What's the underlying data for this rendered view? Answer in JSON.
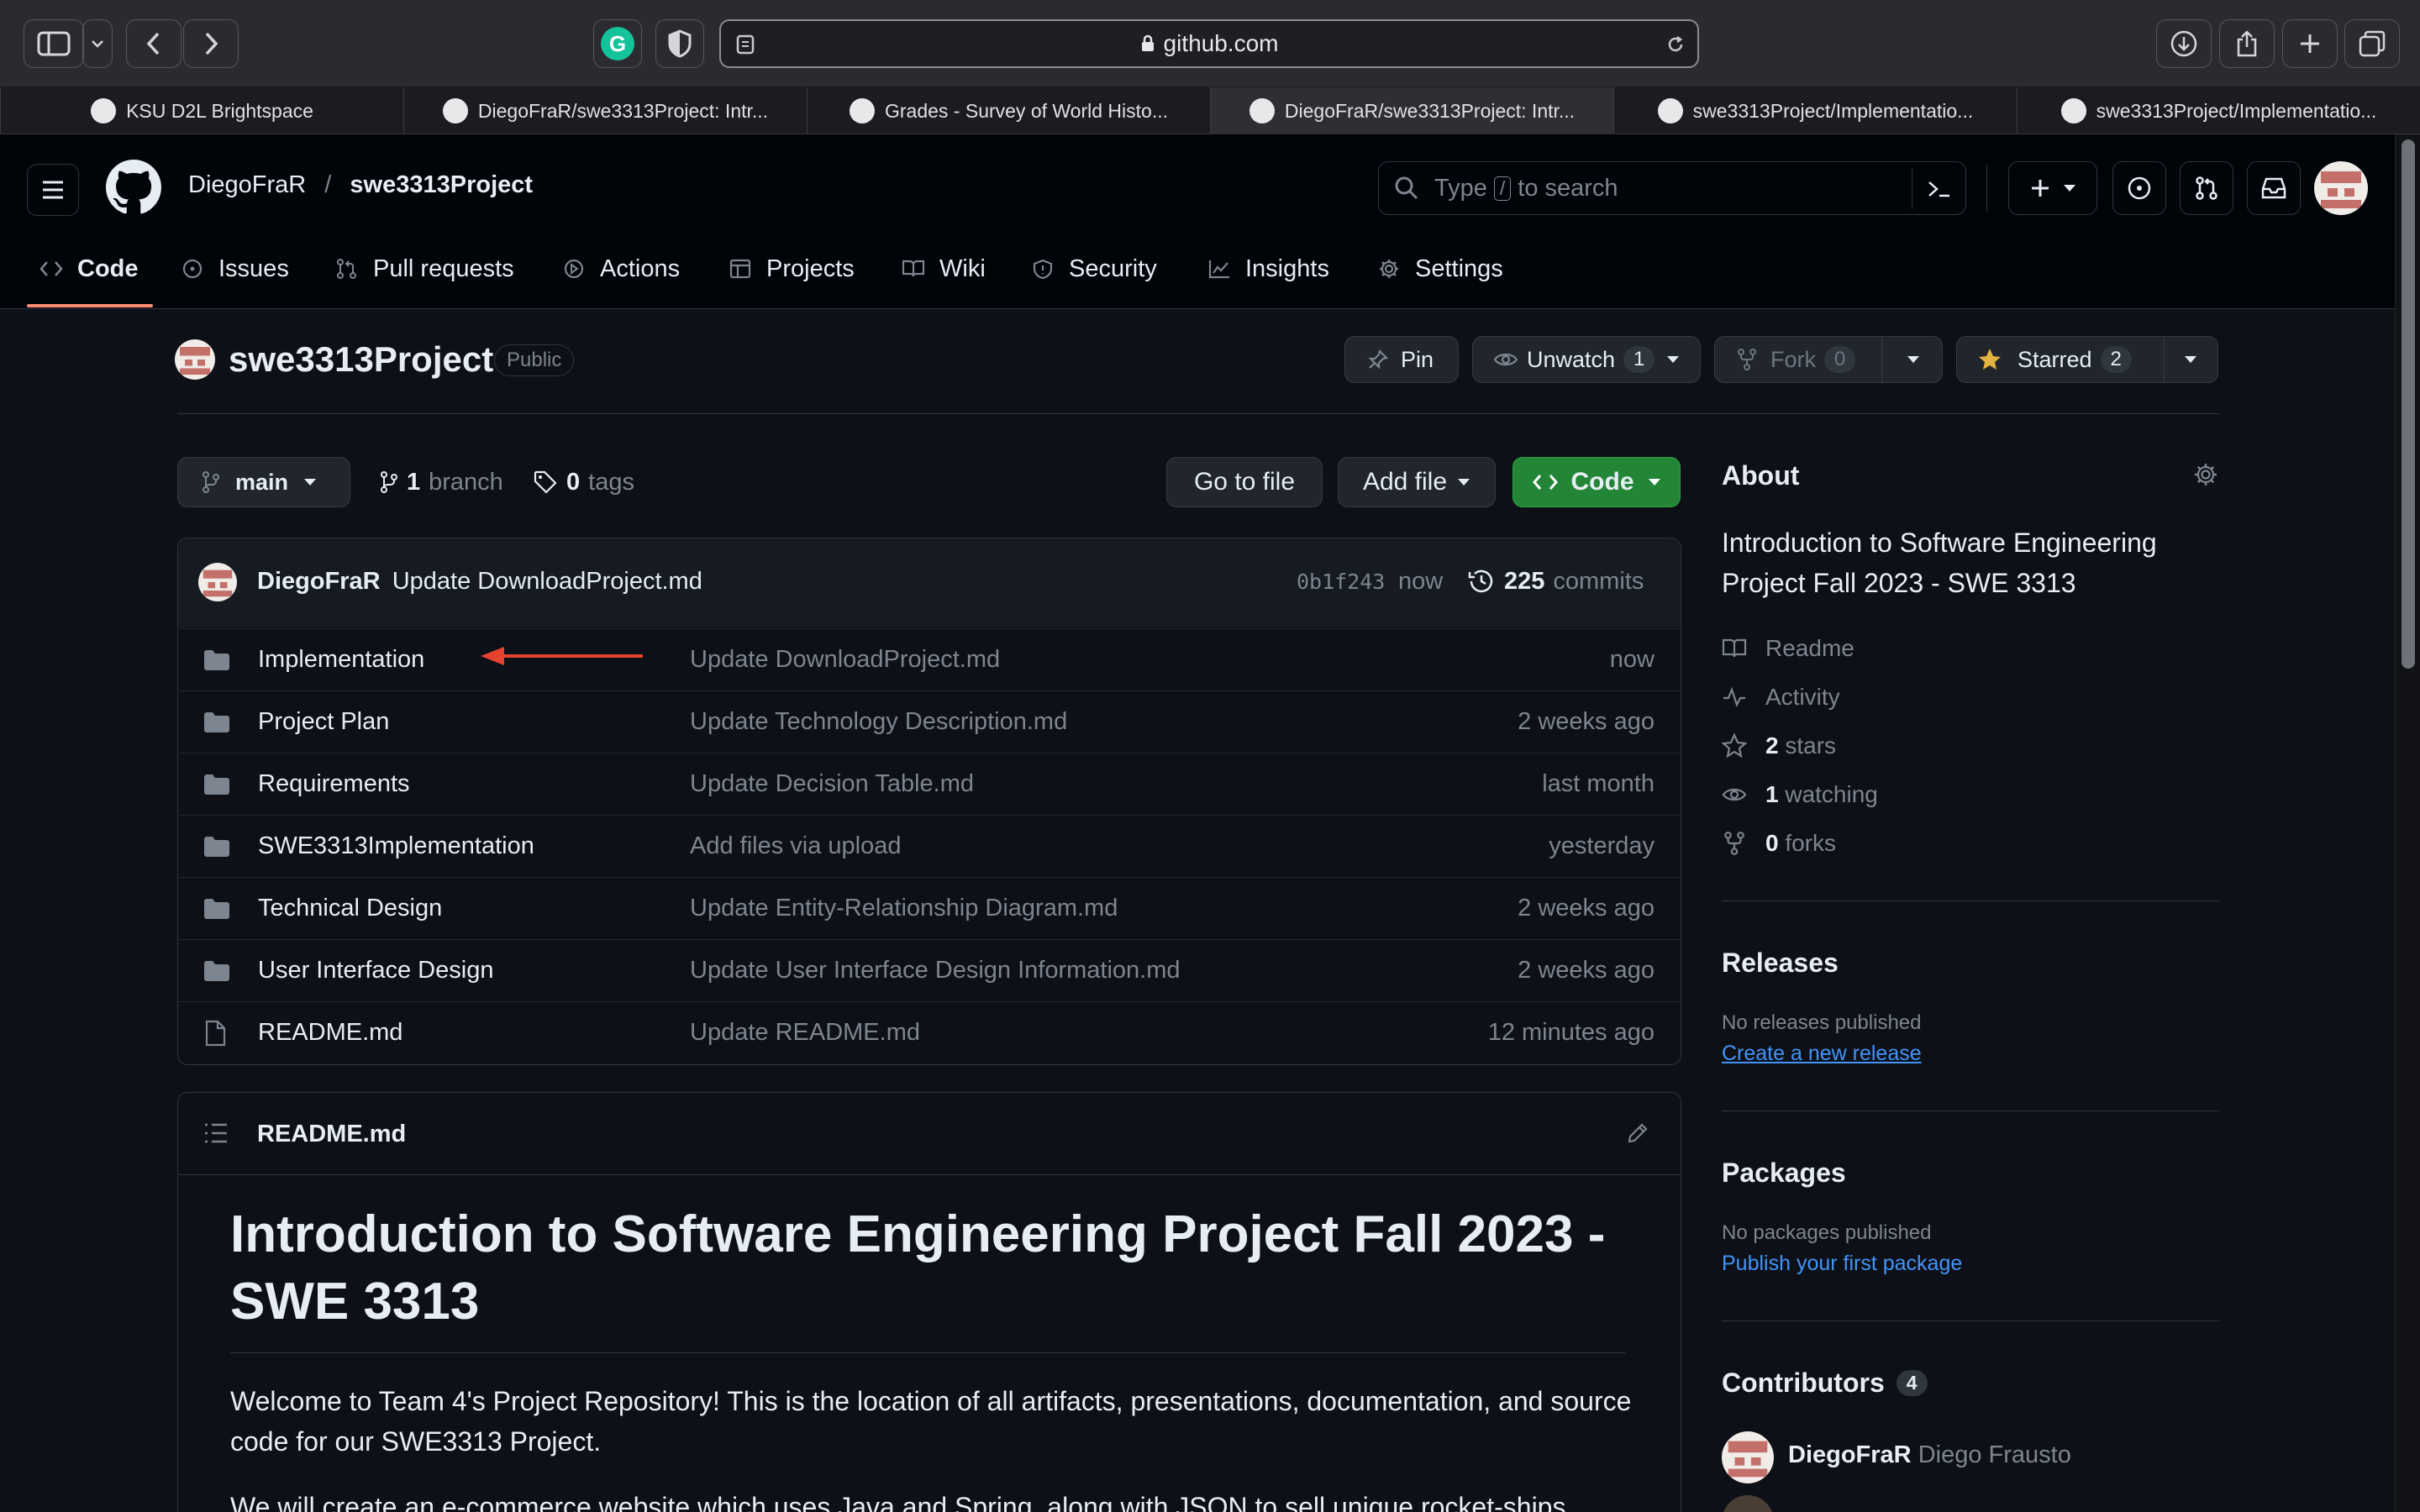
{
  "browser": {
    "url": "github.com",
    "tabs": [
      {
        "title": "KSU D2L Brightspace",
        "active": false
      },
      {
        "title": "DiegoFraR/swe3313Project: Intr...",
        "active": false
      },
      {
        "title": "Grades - Survey of World Histo...",
        "active": false
      },
      {
        "title": "DiegoFraR/swe3313Project: Intr...",
        "active": true
      },
      {
        "title": "swe3313Project/Implementatio...",
        "active": false
      },
      {
        "title": "swe3313Project/Implementatio...",
        "active": false
      }
    ]
  },
  "header": {
    "owner": "DiegoFraR",
    "separator": "/",
    "repo": "swe3313Project",
    "search_placeholder_pre": "Type",
    "search_key": "/",
    "search_placeholder_post": "to search"
  },
  "nav": {
    "tabs": [
      {
        "label": "Code",
        "icon": "code-icon",
        "selected": true
      },
      {
        "label": "Issues",
        "icon": "issue-icon"
      },
      {
        "label": "Pull requests",
        "icon": "pull-request-icon"
      },
      {
        "label": "Actions",
        "icon": "play-icon"
      },
      {
        "label": "Projects",
        "icon": "table-icon"
      },
      {
        "label": "Wiki",
        "icon": "book-icon"
      },
      {
        "label": "Security",
        "icon": "shield-icon"
      },
      {
        "label": "Insights",
        "icon": "graph-icon"
      },
      {
        "label": "Settings",
        "icon": "gear-icon"
      }
    ]
  },
  "repo": {
    "name": "swe3313Project",
    "visibility": "Public",
    "pin_label": "Pin",
    "unwatch_label": "Unwatch",
    "watch_count": "1",
    "fork_label": "Fork",
    "fork_count": "0",
    "starred_label": "Starred",
    "star_count": "2"
  },
  "toolbar": {
    "branch": "main",
    "branch_count": "1",
    "branch_label": "branch",
    "tag_count": "0",
    "tag_label": "tags",
    "goto_file": "Go to file",
    "add_file": "Add file",
    "code": "Code"
  },
  "commit": {
    "author": "DiegoFraR",
    "message": "Update DownloadProject.md",
    "sha": "0b1f243",
    "time": "now",
    "commit_count": "225",
    "commit_label": "commits"
  },
  "files": [
    {
      "name": "Implementation",
      "type": "folder",
      "message": "Update DownloadProject.md",
      "age": "now"
    },
    {
      "name": "Project Plan",
      "type": "folder",
      "message": "Update Technology Description.md",
      "age": "2 weeks ago"
    },
    {
      "name": "Requirements",
      "type": "folder",
      "message": "Update Decision Table.md",
      "age": "last month"
    },
    {
      "name": "SWE3313Implementation",
      "type": "folder",
      "message": "Add files via upload",
      "age": "yesterday"
    },
    {
      "name": "Technical Design",
      "type": "folder",
      "message": "Update Entity-Relationship Diagram.md",
      "age": "2 weeks ago"
    },
    {
      "name": "User Interface Design",
      "type": "folder",
      "message": "Update User Interface Design Information.md",
      "age": "2 weeks ago"
    },
    {
      "name": "README.md",
      "type": "file",
      "message": "Update README.md",
      "age": "12 minutes ago"
    }
  ],
  "readme": {
    "filename": "README.md",
    "title": "Introduction to Software Engineering Project Fall 2023 - SWE 3313",
    "paragraph1": "Welcome to Team 4's Project Repository! This is the location of all artifacts, presentations, documentation, and source code for our SWE3313 Project.",
    "paragraph2": "We will create an e-commerce website which uses Java and Spring, along with JSON to sell unique rocket-ships"
  },
  "about": {
    "heading": "About",
    "description": "Introduction to Software Engineering Project Fall 2023 - SWE 3313",
    "readme": "Readme",
    "activity": "Activity",
    "stars_n": "2",
    "stars": "stars",
    "watching_n": "1",
    "watching": "watching",
    "forks_n": "0",
    "forks": "forks"
  },
  "releases": {
    "heading": "Releases",
    "none": "No releases published",
    "link": "Create a new release"
  },
  "packages": {
    "heading": "Packages",
    "none": "No packages published",
    "link": "Publish your first package"
  },
  "contributors": {
    "heading": "Contributors",
    "count": "4",
    "first_login": "DiegoFraR",
    "first_name": "Diego Frausto"
  },
  "colors": {
    "accent_green": "#238636",
    "link_blue": "#4493f8",
    "annotation_red": "#e5432f",
    "nav_underline": "#fd8c73"
  }
}
